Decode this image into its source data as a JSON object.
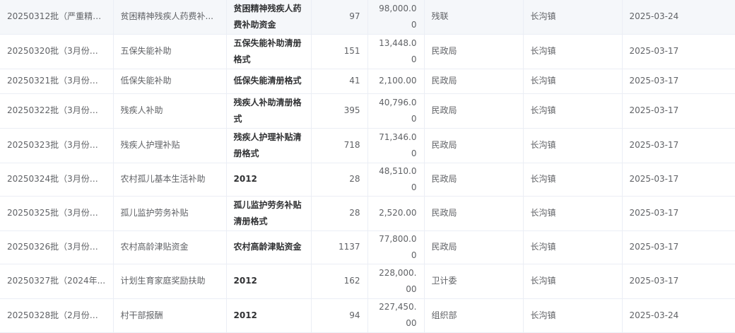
{
  "table": {
    "rows": [
      {
        "batch": "20250312批（严重精神...",
        "item": "贫困精神残疾人药费补...",
        "template": "贫困精神残疾人药费补助资金",
        "count": "97",
        "amount": "98,000.00",
        "dept": "残联",
        "town": "长沟镇",
        "date": "2025-03-24"
      },
      {
        "batch": "20250320批（3月份分...",
        "item": "五保失能补助",
        "template": "五保失能补助清册格式",
        "count": "151",
        "amount": "13,448.00",
        "dept": "民政局",
        "town": "长沟镇",
        "date": "2025-03-17"
      },
      {
        "batch": "20250321批（3月份低...",
        "item": "低保失能补助",
        "template": "低保失能清册格式",
        "count": "41",
        "amount": "2,100.00",
        "dept": "民政局",
        "town": "长沟镇",
        "date": "2025-03-17"
      },
      {
        "batch": "20250322批（3月份困...",
        "item": "残疾人补助",
        "template": "残疾人补助清册格式",
        "count": "395",
        "amount": "40,796.00",
        "dept": "民政局",
        "town": "长沟镇",
        "date": "2025-03-17"
      },
      {
        "batch": "20250323批（3月份重...",
        "item": "残疾人护理补贴",
        "template": "残疾人护理补贴清册格式",
        "count": "718",
        "amount": "71,346.00",
        "dept": "民政局",
        "town": "长沟镇",
        "date": "2025-03-17"
      },
      {
        "batch": "20250324批（3月份孤...",
        "item": "农村孤儿基本生活补助",
        "template": "2012",
        "count": "28",
        "amount": "48,510.00",
        "dept": "民政局",
        "town": "长沟镇",
        "date": "2025-03-17"
      },
      {
        "batch": "20250325批（3月份孤...",
        "item": "孤儿监护劳务补贴",
        "template": "孤儿监护劳务补贴清册格式",
        "count": "28",
        "amount": "2,520.00",
        "dept": "民政局",
        "town": "长沟镇",
        "date": "2025-03-17"
      },
      {
        "batch": "20250326批（3月份高...",
        "item": "农村高龄津贴资金",
        "template": "农村高龄津贴资金",
        "count": "1137",
        "amount": "77,800.00",
        "dept": "民政局",
        "town": "长沟镇",
        "date": "2025-03-17"
      },
      {
        "batch": "20250327批（2024年...",
        "item": "计划生育家庭奖励扶助",
        "template": "2012",
        "count": "162",
        "amount": "228,000.00",
        "dept": "卫计委",
        "town": "长沟镇",
        "date": "2025-03-17"
      },
      {
        "batch": "20250328批（2月份村...",
        "item": "村干部报酬",
        "template": "2012",
        "count": "94",
        "amount": "227,450.00",
        "dept": "组织部",
        "town": "长沟镇",
        "date": "2025-03-24"
      }
    ]
  }
}
